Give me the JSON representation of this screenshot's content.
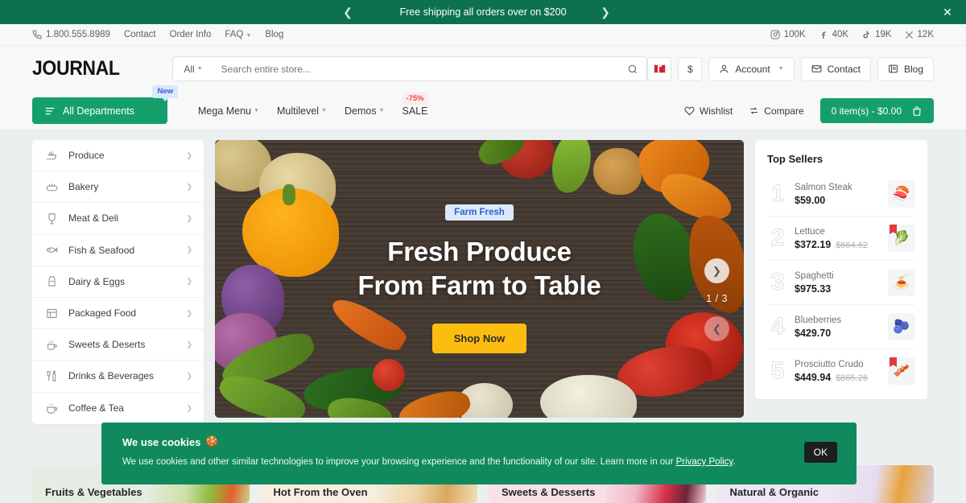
{
  "promo": {
    "message": "Free shipping all orders over on $200",
    "prev_icon": "chevron-left-icon",
    "next_icon": "chevron-right-icon",
    "close_icon": "close-icon"
  },
  "topbar": {
    "phone": "1.800.555.8989",
    "links": [
      "Contact",
      "Order Info",
      "FAQ",
      "Blog"
    ],
    "socials": [
      {
        "icon": "instagram-icon",
        "count": "100K"
      },
      {
        "icon": "facebook-icon",
        "count": "40K"
      },
      {
        "icon": "tiktok-icon",
        "count": "19K"
      },
      {
        "icon": "x-twitter-icon",
        "count": "12K"
      }
    ]
  },
  "header": {
    "logo": "JOURNAL",
    "search": {
      "category": "All",
      "placeholder": "Search entire store...",
      "value": ""
    },
    "language_icon": "flag-icon",
    "currency": "$",
    "account": "Account",
    "contact": "Contact",
    "blog": "Blog"
  },
  "nav": {
    "departments": "All Departments",
    "departments_badge": "New",
    "links": [
      {
        "label": "Mega Menu",
        "caret": true
      },
      {
        "label": "Multilevel",
        "caret": true
      },
      {
        "label": "Demos",
        "caret": true
      },
      {
        "label": "SALE",
        "caret": false,
        "badge": "-75%"
      }
    ],
    "wishlist": "Wishlist",
    "compare": "Compare",
    "cart": "0 item(s) - $0.00"
  },
  "categories": [
    {
      "label": "Produce",
      "icon": "produce-icon"
    },
    {
      "label": "Bakery",
      "icon": "bakery-icon"
    },
    {
      "label": "Meat & Deli",
      "icon": "meat-icon"
    },
    {
      "label": "Fish & Seafood",
      "icon": "fish-icon"
    },
    {
      "label": "Dairy & Eggs",
      "icon": "dairy-icon"
    },
    {
      "label": "Packaged Food",
      "icon": "packaged-food-icon"
    },
    {
      "label": "Sweets & Deserts",
      "icon": "sweets-icon"
    },
    {
      "label": "Drinks & Beverages",
      "icon": "drinks-icon"
    },
    {
      "label": "Coffee & Tea",
      "icon": "coffee-icon"
    }
  ],
  "hero": {
    "tag": "Farm Fresh",
    "line1": "Fresh Produce",
    "line2": "From Farm to Table",
    "cta": "Shop Now",
    "counter": "1 / 3"
  },
  "sellers": {
    "title": "Top Sellers",
    "items": [
      {
        "rank": "1",
        "name": "Salmon Steak",
        "price": "$59.00",
        "old_price": "",
        "thumb": "🍣",
        "on_sale": false
      },
      {
        "rank": "2",
        "name": "Lettuce",
        "price": "$372.19",
        "old_price": "$664.62",
        "thumb": "🥬",
        "on_sale": true
      },
      {
        "rank": "3",
        "name": "Spaghetti",
        "price": "$975.33",
        "old_price": "",
        "thumb": "🍝",
        "on_sale": false
      },
      {
        "rank": "4",
        "name": "Blueberries",
        "price": "$429.70",
        "old_price": "",
        "thumb": "🫐",
        "on_sale": false
      },
      {
        "rank": "5",
        "name": "Prosciutto Crudo",
        "price": "$449.94",
        "old_price": "$865.26",
        "thumb": "🥓",
        "on_sale": true
      }
    ]
  },
  "tiles": [
    {
      "label": "Fruits & Vegetables",
      "color": "#e6ece2"
    },
    {
      "label": "Hot From the Oven",
      "color": "#f6ecdd"
    },
    {
      "label": "Sweets & Desserts",
      "color": "#f8dde6"
    },
    {
      "label": "Natural & Organic",
      "color": "#ece4f2"
    }
  ],
  "cookie": {
    "title": "We use cookies",
    "title_icon": "cookie-icon",
    "text_before": "We use cookies and other similar technologies to improve your browsing experience and the functionality of our site. Learn more in our ",
    "link": "Privacy Policy",
    "text_after": ".",
    "ok": "OK"
  }
}
